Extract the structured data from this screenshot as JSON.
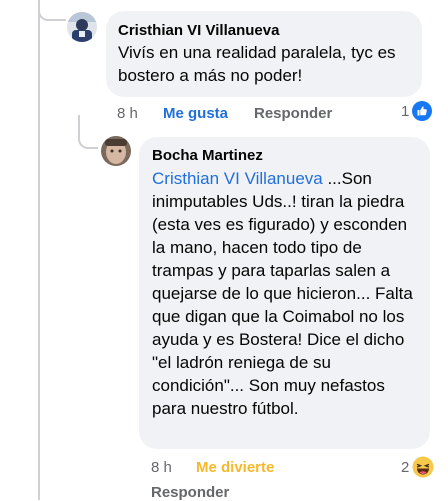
{
  "comment1": {
    "author": "Cristhian VI Villanueva",
    "text": "Vivís en una realidad paralela, tyc es bostero a más no poder!",
    "time": "8 h",
    "like_label": "Me gusta",
    "reply_label": "Responder",
    "reaction_count": "1",
    "reaction_icon": "like-icon"
  },
  "comment2": {
    "author": "Bocha Martinez",
    "mention": "Cristhian VI Villanueva",
    "text": " ...Son inimputables Uds..! tiran la piedra (esta ves es figurado) y esconden la mano, hacen todo tipo de trampas y para taparlas salen a quejarse de lo que hicieron... Falta que digan que la Coimabol no los ayuda y es Bostera! Dice el dicho \"el ladrón reniega de su condición\"... Son muy nefastos para nuestro fútbol.",
    "time": "8 h",
    "reaction_label": "Me divierte",
    "reply_label": "Responder",
    "reaction_count": "2",
    "reaction_icon": "haha-icon"
  },
  "colors": {
    "link": "#216fdb",
    "haha": "#f7b928",
    "muted": "#65676b",
    "bubble": "#f0f2f5"
  }
}
